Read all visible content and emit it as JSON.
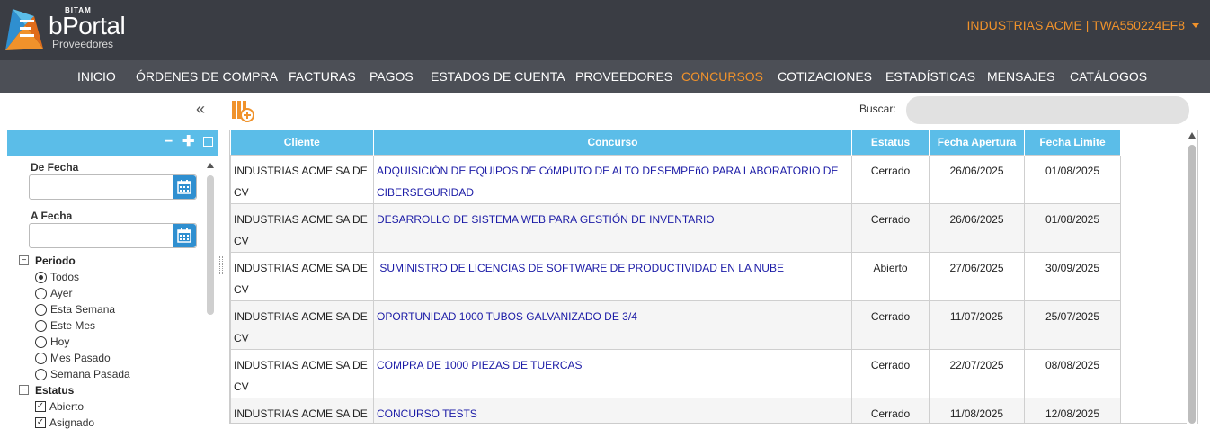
{
  "brand": {
    "maker": "BITAM",
    "name": "bPortal",
    "subtitle": "Proveedores"
  },
  "account": {
    "label": "INDUSTRIAS ACME | TWA550224EF8"
  },
  "colors": {
    "header_bg": "#3a3d44",
    "nav_bg": "#4c4f56",
    "accent": "#f0922b",
    "grid_header": "#5bbde8",
    "link": "#1a1aa6"
  },
  "nav": {
    "items": [
      {
        "label": "INICIO"
      },
      {
        "label": "ÓRDENES DE COMPRA"
      },
      {
        "label": "FACTURAS"
      },
      {
        "label": "PAGOS"
      },
      {
        "label": "ESTADOS DE CUENTA"
      },
      {
        "label": "PROVEEDORES"
      },
      {
        "label": "CONCURSOS"
      },
      {
        "label": "COTIZACIONES"
      },
      {
        "label": "ESTADÍSTICAS"
      },
      {
        "label": "MENSAJES"
      },
      {
        "label": "CATÁLOGOS"
      }
    ],
    "active": "CONCURSOS"
  },
  "sidebar": {
    "collapse_icon": "double-chevron-left-icon",
    "toolbar": {
      "minus": "−",
      "plus": "✚"
    },
    "from_date_label": "De Fecha",
    "to_date_label": "A Fecha",
    "from_date_value": "",
    "to_date_value": "",
    "period": {
      "title": "Periodo",
      "toggle": "−",
      "options": [
        {
          "label": "Todos",
          "selected": true
        },
        {
          "label": "Ayer",
          "selected": false
        },
        {
          "label": "Esta Semana",
          "selected": false
        },
        {
          "label": "Este Mes",
          "selected": false
        },
        {
          "label": "Hoy",
          "selected": false
        },
        {
          "label": "Mes Pasado",
          "selected": false
        },
        {
          "label": "Semana Pasada",
          "selected": false
        }
      ]
    },
    "status": {
      "title": "Estatus",
      "toggle": "−",
      "options": [
        {
          "label": "Abierto",
          "checked": true
        },
        {
          "label": "Asignado",
          "checked": true
        }
      ]
    }
  },
  "search": {
    "label": "Buscar:",
    "value": ""
  },
  "grid": {
    "columns": [
      "Cliente",
      "Concurso",
      "Estatus",
      "Fecha Apertura",
      "Fecha Limite"
    ],
    "rows": [
      {
        "cliente": "INDUSTRIAS ACME SA DE CV",
        "concurso": "ADQUISICIÓN DE EQUIPOS DE CóMPUTO DE ALTO DESEMPEñO PARA LABORATORIO DE CIBERSEGURIDAD",
        "estatus": "Cerrado",
        "apertura": "26/06/2025",
        "limite": "01/08/2025"
      },
      {
        "cliente": "INDUSTRIAS ACME SA DE CV",
        "concurso": "DESARROLLO DE SISTEMA WEB PARA GESTIÓN DE INVENTARIO",
        "estatus": "Cerrado",
        "apertura": "26/06/2025",
        "limite": "01/08/2025"
      },
      {
        "cliente": "INDUSTRIAS ACME SA DE CV",
        "concurso": " SUMINISTRO DE LICENCIAS DE SOFTWARE DE PRODUCTIVIDAD EN LA NUBE",
        "estatus": "Abierto",
        "apertura": "27/06/2025",
        "limite": "30/09/2025"
      },
      {
        "cliente": "INDUSTRIAS ACME SA DE CV",
        "concurso": "OPORTUNIDAD 1000 TUBOS GALVANIZADO DE 3/4",
        "estatus": "Cerrado",
        "apertura": "11/07/2025",
        "limite": "25/07/2025"
      },
      {
        "cliente": "INDUSTRIAS ACME SA DE CV",
        "concurso": "COMPRA DE 1000 PIEZAS DE TUERCAS",
        "estatus": "Cerrado",
        "apertura": "22/07/2025",
        "limite": "08/08/2025"
      },
      {
        "cliente": "INDUSTRIAS ACME SA DE CV",
        "concurso": "CONCURSO TESTS",
        "estatus": "Cerrado",
        "apertura": "11/08/2025",
        "limite": "12/08/2025"
      }
    ]
  }
}
